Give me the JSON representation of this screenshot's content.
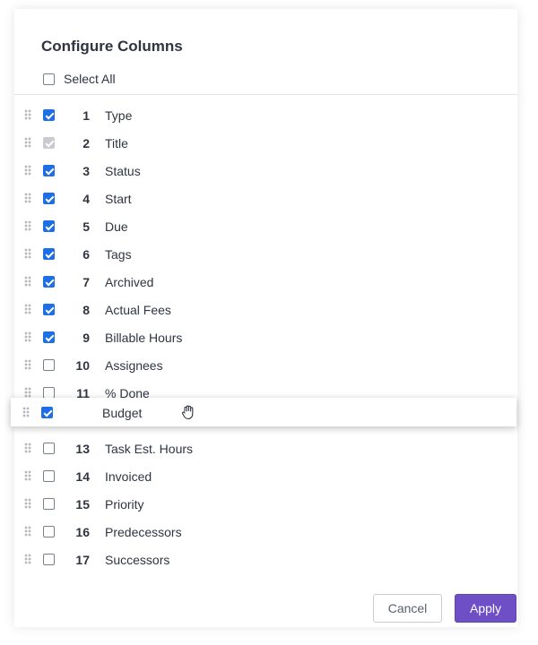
{
  "dialog": {
    "title": "Configure Columns",
    "select_all_label": "Select All",
    "select_all_checked": false
  },
  "columns": [
    {
      "num": "1",
      "label": "Type",
      "state": "checked"
    },
    {
      "num": "2",
      "label": "Title",
      "state": "disabled"
    },
    {
      "num": "3",
      "label": "Status",
      "state": "checked"
    },
    {
      "num": "4",
      "label": "Start",
      "state": "checked"
    },
    {
      "num": "5",
      "label": "Due",
      "state": "checked"
    },
    {
      "num": "6",
      "label": "Tags",
      "state": "checked"
    },
    {
      "num": "7",
      "label": "Archived",
      "state": "checked"
    },
    {
      "num": "8",
      "label": "Actual Fees",
      "state": "checked"
    },
    {
      "num": "9",
      "label": "Billable Hours",
      "state": "checked"
    },
    {
      "num": "10",
      "label": "Assignees",
      "state": "unchecked"
    },
    {
      "num": "11",
      "label": "% Done",
      "state": "unchecked"
    },
    {
      "num": "13",
      "label": "Task Est. Hours",
      "state": "unchecked"
    },
    {
      "num": "14",
      "label": "Invoiced",
      "state": "unchecked"
    },
    {
      "num": "15",
      "label": "Priority",
      "state": "unchecked"
    },
    {
      "num": "16",
      "label": "Predecessors",
      "state": "unchecked"
    },
    {
      "num": "17",
      "label": "Successors",
      "state": "unchecked"
    }
  ],
  "dragging": {
    "label": "Budget",
    "state": "checked",
    "cursor_icon": "grab-hand-icon"
  },
  "footer": {
    "cancel_label": "Cancel",
    "apply_label": "Apply"
  },
  "colors": {
    "checkbox_checked": "#1e6fe6",
    "apply_button": "#6f4fc6",
    "checkbox_disabled": "#c9cbd0"
  }
}
